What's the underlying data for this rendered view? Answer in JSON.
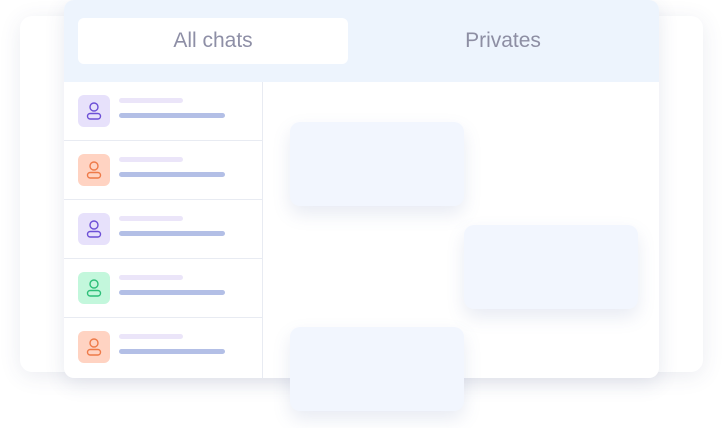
{
  "tabs": [
    {
      "label": "All chats",
      "active": true
    },
    {
      "label": "Privates",
      "active": false
    }
  ],
  "chats": [
    {
      "avatar_color": "#e7e1fb",
      "icon_color": "#6c4fd6",
      "icon": "user-icon"
    },
    {
      "avatar_color": "#ffd3c2",
      "icon_color": "#ee7a48",
      "icon": "user-icon"
    },
    {
      "avatar_color": "#e7e1fb",
      "icon_color": "#6c4fd6",
      "icon": "user-icon"
    },
    {
      "avatar_color": "#c3f7dc",
      "icon_color": "#2dbf79",
      "icon": "user-icon"
    },
    {
      "avatar_color": "#ffd3c2",
      "icon_color": "#ee7a48",
      "icon": "user-icon"
    }
  ],
  "colors": {
    "tab_bar_bg": "#edf4fd",
    "tab_text": "#8d8ea3",
    "bubble_bg": "#f2f6fe",
    "placeholder_line_light": "#ebe5f9",
    "placeholder_line_dark": "#b3bfe6"
  }
}
